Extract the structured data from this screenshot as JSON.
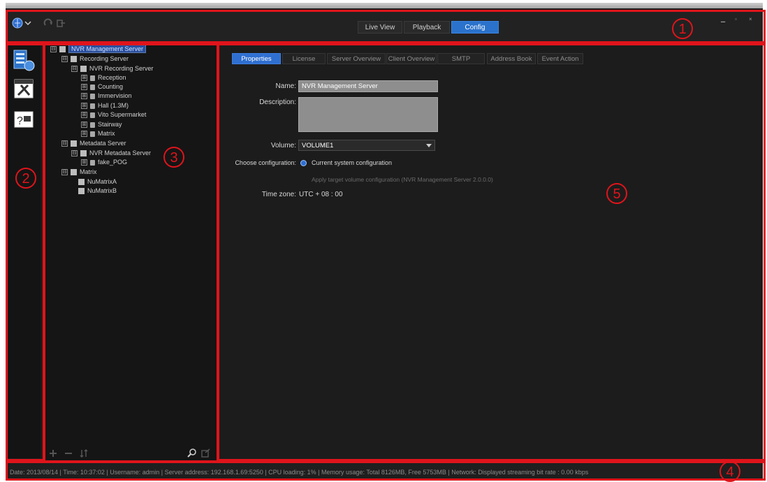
{
  "window": {
    "min_glyph": "▁",
    "max_glyph": "▫",
    "close_glyph": "×"
  },
  "toolbar": {
    "mode_tabs": [
      {
        "label": "Live View",
        "active": false
      },
      {
        "label": "Playback",
        "active": false
      },
      {
        "label": "Config",
        "active": true
      }
    ]
  },
  "sidebar": {
    "items": [
      {
        "name": "server-config-icon"
      },
      {
        "name": "tools-config-icon"
      },
      {
        "name": "help-config-icon"
      }
    ]
  },
  "tree": {
    "root": "NVR Management Server",
    "recording_server": "Recording Server",
    "nvr_recording_server": "NVR Recording Server",
    "cameras": [
      "Reception",
      "Counting",
      "Immervision",
      "Hall (1.3M)",
      "Vito Supermarket",
      "Stairway",
      "Matrix"
    ],
    "metadata_server": "Metadata Server",
    "nvr_metadata_server": "NVR Metadata Server",
    "metadata_child": "fake_POG",
    "matrix": "Matrix",
    "matrix_children": [
      "NuMatrixA",
      "NuMatrixB"
    ],
    "expand_glyph": "⊟",
    "collapse_glyph": "⊞"
  },
  "tabs": [
    {
      "label": "Properties",
      "active": true
    },
    {
      "label": "License",
      "active": false
    },
    {
      "label": "Server Overview",
      "active": false
    },
    {
      "label": "Client Overview",
      "active": false
    },
    {
      "label": "SMTP",
      "active": false
    },
    {
      "label": "Address Book",
      "active": false
    },
    {
      "label": "Event Action",
      "active": false
    }
  ],
  "form": {
    "name_label": "Name:",
    "name_value": "NVR Management Server",
    "description_label": "Description:",
    "volume_label": "Volume:",
    "volume_value": "VOLUME1",
    "choose_label": "Choose configuration:",
    "option_current": "Current system configuration",
    "option_apply": "Apply target volume configuration (NVR Management Server 2.0.0.0)",
    "timezone_label": "Time zone:",
    "timezone_value": "UTC + 08 : 00"
  },
  "status": {
    "text": "Date: 2013/08/14  |  Time: 10:37:02  |  Username: admin  |  Server address: 192.168.1.69:5250  |  CPU loading: 1%  |  Memory usage: Total 8126MB, Free 5753MB  |  Network: Displayed streaming bit rate : 0.00 kbps"
  },
  "annotations": [
    "1",
    "2",
    "3",
    "4",
    "5"
  ],
  "colors": {
    "accent": "#2a72cc",
    "annotation": "#e0141b",
    "background": "#1d1d1d"
  }
}
